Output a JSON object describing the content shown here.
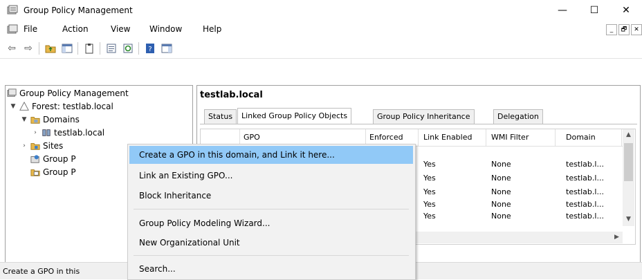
{
  "window": {
    "title": "Group Policy Management",
    "minimize_glyph": "—",
    "maximize_glyph": "☐",
    "close_glyph": "✕"
  },
  "menubar": {
    "items": [
      "File",
      "Action",
      "View",
      "Window",
      "Help"
    ],
    "child_min_glyph": "_",
    "child_restore_glyph": "🗗",
    "child_close_glyph": "✕"
  },
  "toolbar": {
    "back_glyph": "⇦",
    "forward_glyph": "⇨"
  },
  "tree": {
    "root": "Group Policy Management",
    "forest": "Forest: testlab.local",
    "domains": "Domains",
    "domain_node": "testlab.local",
    "sites": "Sites",
    "gp_modeling": "Group P",
    "gp_results": "Group P"
  },
  "right": {
    "heading": "testlab.local",
    "tabs": [
      "Status",
      "Linked Group Policy Objects",
      "Group Policy Inheritance",
      "Delegation"
    ],
    "columns": [
      "",
      "GPO",
      "Enforced",
      "Link Enabled",
      "WMI Filter",
      "Domain"
    ],
    "rows": [
      {
        "link_enabled": "Yes",
        "wmi": "None",
        "domain": "testlab.l..."
      },
      {
        "link_enabled": "Yes",
        "wmi": "None",
        "domain": "testlab.l..."
      },
      {
        "link_enabled": "Yes",
        "wmi": "None",
        "domain": "testlab.l..."
      },
      {
        "link_enabled": "Yes",
        "wmi": "None",
        "domain": "testlab.l..."
      },
      {
        "link_enabled": "Yes",
        "wmi": "None",
        "domain": "testlab.l..."
      }
    ]
  },
  "context_menu": {
    "items": [
      "Create a GPO in this domain, and Link it here...",
      "Link an Existing GPO...",
      "Block Inheritance",
      "Group Policy Modeling Wizard...",
      "New Organizational Unit",
      "Search..."
    ]
  },
  "statusbar": {
    "text": "Create a GPO in this"
  }
}
